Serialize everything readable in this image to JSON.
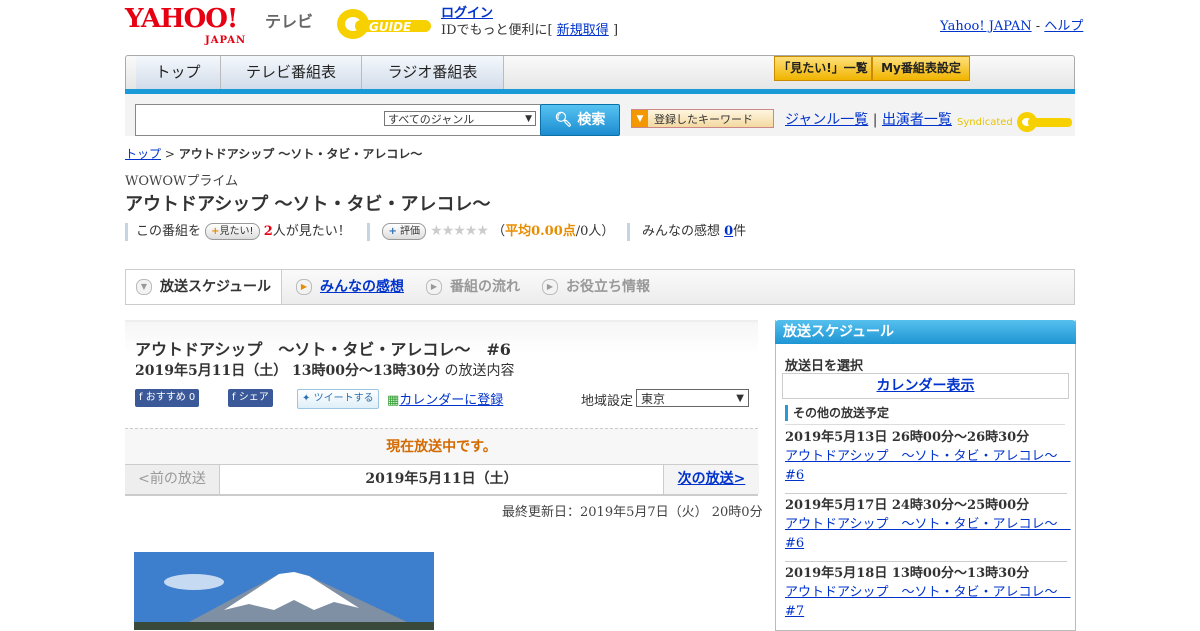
{
  "header": {
    "yahoo_logo": "YAHOO!",
    "yahoo_logo_sub": "JAPAN",
    "tv_logo": "テレビ",
    "gguide_logo": "GUIDE",
    "login": "ログイン",
    "login_note_prefix": "IDでもっと便利に[",
    "register": "新規取得",
    "login_note_suffix": "]",
    "yahoo_japan_link": "Yahoo! JAPAN",
    "separator": "-",
    "help_link": "ヘルプ"
  },
  "nav": {
    "tabs": [
      "トップ",
      "テレビ番組表",
      "ラジオ番組表"
    ],
    "want_list": "「見たい!」一覧",
    "my_schedule": "My番組表設定"
  },
  "search": {
    "genre_selected": "すべてのジャンル",
    "button": "検索",
    "keyword_button": "登録したキーワード",
    "genre_list": "ジャンル一覧",
    "divider": "|",
    "cast_list": "出演者一覧",
    "syndicated": "Syndicated"
  },
  "breadcrumb": {
    "top": "トップ",
    "sep": ">",
    "current": "アウトドアシップ ～ソト・タビ・アレコレ～"
  },
  "program": {
    "channel": "WOWOWプライム",
    "title": "アウトドアシップ ～ソト・タビ・アレコレ～",
    "this_program": "この番組を",
    "want_button": "見たい!",
    "want_count": "2",
    "want_suffix": "人が見たい！",
    "rate_button": "評価",
    "stars": "★★★★★",
    "rating_open": "（",
    "rating_avg": "平均0.00点",
    "rating_people": "/0人）",
    "impressions_label": "みんなの感想",
    "impressions_count": "0",
    "impressions_unit": "件"
  },
  "tabs": [
    {
      "label": "放送スケジュール",
      "state": "active"
    },
    {
      "label": "みんなの感想",
      "state": "link"
    },
    {
      "label": "番組の流れ",
      "state": "disabled"
    },
    {
      "label": "お役立ち情報",
      "state": "disabled"
    }
  ],
  "episode": {
    "title": "アウトドアシップ　～ソト・タビ・アレコレ～　#6",
    "datetime": "2019年5月11日（土） 13時00分～13時30分",
    "datetime_suffix": "の放送内容",
    "fb_recommend": "おすすめ 0",
    "fb_share": "シェア",
    "tweet": "ツイートする",
    "calendar": "カレンダーに登録",
    "area_label": "地域設定",
    "area_value": "東京",
    "onair_notice": "現在放送中です。",
    "prev": "<前の放送",
    "pager_date": "2019年5月11日（土）",
    "next": "次の放送>",
    "updated": "最終更新日：2019年5月7日（火） 20時0分"
  },
  "sidebar": {
    "header": "放送スケジュール",
    "date_select": "放送日を選択",
    "calendar_button": "カレンダー表示",
    "other_header": "その他の放送予定",
    "items": [
      {
        "datetime": "2019年5月13日 26時00分～26時30分",
        "title": "アウトドアシップ　～ソト・タビ・アレコレ～　#6"
      },
      {
        "datetime": "2019年5月17日 24時30分～25時00分",
        "title": "アウトドアシップ　～ソト・タビ・アレコレ～　#6"
      },
      {
        "datetime": "2019年5月18日 13時00分～13時30分",
        "title": "アウトドアシップ　～ソト・タビ・アレコレ～　#7"
      }
    ]
  },
  "colors": {
    "brand_red": "#e60012",
    "accent_blue": "#1a9ad6",
    "link": "#0033cc",
    "notice_orange": "#d46b00"
  }
}
